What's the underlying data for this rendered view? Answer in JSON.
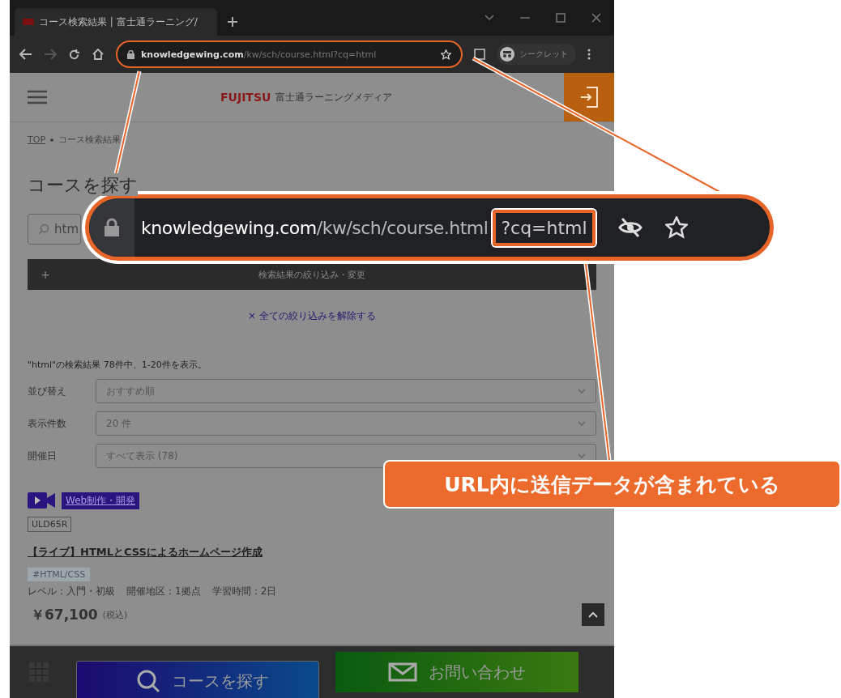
{
  "browser": {
    "tabs": [
      {
        "title": "コース検索結果 | 富士通ラーニング/",
        "selected": true
      }
    ],
    "url": {
      "host": "knowledgewing.com",
      "path": "/kw/sch/course.html?cq=html"
    },
    "profile": "シークレット"
  },
  "site": {
    "logo": "FUJITSU",
    "name": "富士通ラーニングメディア"
  },
  "breadcrumb": [
    "TOP",
    "コース検索結果"
  ],
  "heading": "コースを探す",
  "search": {
    "value": "htm"
  },
  "filter_bar": {
    "icon": "+",
    "label": "検索結果の絞り込み・変更"
  },
  "clear_link": "× 全ての絞り込みを解除する",
  "result_summary": "\"html\"の検索結果 78件中、1-20件を表示。",
  "sort_rows": [
    {
      "label": "並び替え",
      "value": "おすすめ順"
    },
    {
      "label": "表示件数",
      "value": "20 件"
    },
    {
      "label": "開催日",
      "value": "すべて表示 (78)"
    }
  ],
  "course": {
    "category": "Web制作・開発",
    "code": "ULD65R",
    "title": "【ライブ】HTMLとCSSによるホームページ作成",
    "tag": "#HTML/CSS",
    "meta": [
      "レベル：入門・初級",
      "開催地区：1拠点",
      "学習時間：2日"
    ],
    "price": "￥67,100",
    "tax": "(税込)"
  },
  "footer_buttons": [
    {
      "label": "コースを探す",
      "kind": "search"
    },
    {
      "label": "お問い合わせ",
      "kind": "mail"
    }
  ],
  "zoomed_url": {
    "host": "knowledgewing.com",
    "path": "/kw/sch/course.html",
    "query": "?cq=html"
  },
  "note": "URL内に送信データが含まれている"
}
